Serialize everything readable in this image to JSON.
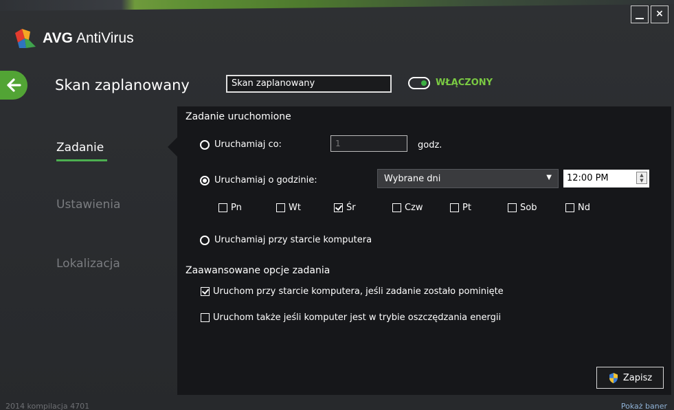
{
  "window": {
    "minimize_label": "_",
    "close_label": "×"
  },
  "app": {
    "brand": "AVG",
    "product": "AntiVirus"
  },
  "header": {
    "title": "Skan zaplanowany",
    "name_value": "Skan zaplanowany",
    "toggle_label": "WŁĄCZONY",
    "toggle_on": true
  },
  "sidebar": {
    "items": [
      {
        "label": "Zadanie",
        "active": true
      },
      {
        "label": "Ustawienia",
        "active": false
      },
      {
        "label": "Lokalizacja",
        "active": false
      }
    ]
  },
  "task": {
    "section_title": "Zadanie uruchomione",
    "run_every_label": "Uruchamiaj co:",
    "run_every_value": "1",
    "run_every_unit": "godz.",
    "run_at_label": "Uruchamiaj o godzinie:",
    "run_at_selected": true,
    "days_select": "Wybrane dni",
    "time_value": "12:00 PM",
    "days": [
      {
        "label": "Pn",
        "checked": false
      },
      {
        "label": "Wt",
        "checked": false
      },
      {
        "label": "Śr",
        "checked": true
      },
      {
        "label": "Czw",
        "checked": false
      },
      {
        "label": "Pt",
        "checked": false
      },
      {
        "label": "Sob",
        "checked": false
      },
      {
        "label": "Nd",
        "checked": false
      }
    ],
    "startup_label": "Uruchamiaj przy starcie komputera"
  },
  "advanced": {
    "section_title": "Zaawansowane opcje zadania",
    "option1_label": "Uruchom przy starcie komputera, jeśli zadanie zostało pominięte",
    "option1_checked": true,
    "option2_label": "Uruchom także jeśli komputer jest w trybie oszczędzania energii",
    "option2_checked": false
  },
  "footer": {
    "save_label": "Zapisz",
    "build": "2014  kompilacja 4701",
    "banner_link": "Pokaż baner"
  },
  "colors": {
    "accent_green": "#52a435",
    "toggle_text": "#7ac943",
    "panel_bg": "#16171a",
    "window_bg": "#2b2d30"
  }
}
